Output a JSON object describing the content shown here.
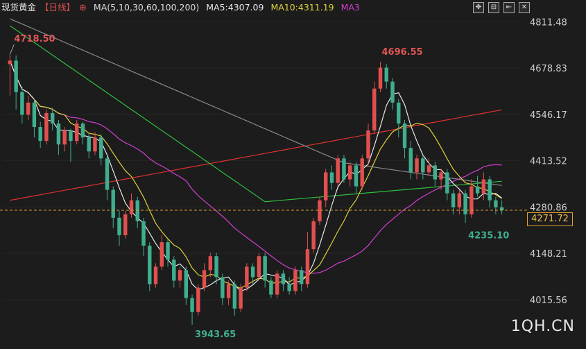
{
  "header": {
    "title": "现货黄金",
    "period": "【日线】",
    "plus": "⊕",
    "ma_label": "MA(5,10,30,60,100,200)",
    "ma5": "MA5:4307.09",
    "ma10": "MA10:4311.19",
    "ma3": "MA3"
  },
  "toolbar": {
    "btn1": "✥",
    "btn2": "⊟",
    "btn3": "⇤",
    "btn4": "✕"
  },
  "watermark": "1QH.CN",
  "current_price": "4271.72",
  "chart_data": {
    "type": "candlestick",
    "y_ticks": [
      "4811.48",
      "4678.83",
      "4546.17",
      "4413.52",
      "4280.86",
      "4148.21",
      "4015.56"
    ],
    "y_tick_values": [
      4811.48,
      4678.83,
      4546.17,
      4413.52,
      4280.86,
      4148.21,
      4015.56
    ],
    "ylim": [
      3900,
      4830
    ],
    "current": 4271.72,
    "annotations": {
      "high_left": "4718.50",
      "high_right": "4696.55",
      "low_mid": "3943.65",
      "low_right": "4235.10"
    },
    "colors": {
      "up": "#e0504f",
      "down": "#3fae8f",
      "ma5": "#e8e8e8",
      "ma10": "#e0d23b",
      "ma30": "#d23fd2",
      "ma60": "#2fbf3f",
      "ma100": "#8a8a8a",
      "ma200": "#e0302f",
      "current_line": "#e0a030"
    },
    "candles": [
      [
        4690,
        4700,
        4718.5,
        4600
      ],
      [
        4700,
        4610,
        4715,
        4560
      ],
      [
        4610,
        4545,
        4625,
        4520
      ],
      [
        4545,
        4580,
        4600,
        4530
      ],
      [
        4580,
        4510,
        4590,
        4480
      ],
      [
        4510,
        4470,
        4525,
        4450
      ],
      [
        4470,
        4550,
        4560,
        4460
      ],
      [
        4550,
        4520,
        4565,
        4500
      ],
      [
        4520,
        4460,
        4530,
        4430
      ],
      [
        4460,
        4500,
        4510,
        4440
      ],
      [
        4500,
        4470,
        4505,
        4410
      ],
      [
        4470,
        4520,
        4530,
        4460
      ],
      [
        4520,
        4480,
        4525,
        4460
      ],
      [
        4480,
        4440,
        4490,
        4420
      ],
      [
        4440,
        4480,
        4495,
        4430
      ],
      [
        4480,
        4420,
        4490,
        4400
      ],
      [
        4420,
        4330,
        4430,
        4300
      ],
      [
        4330,
        4250,
        4340,
        4220
      ],
      [
        4250,
        4200,
        4270,
        4170
      ],
      [
        4200,
        4260,
        4270,
        4190
      ],
      [
        4260,
        4300,
        4320,
        4250
      ],
      [
        4300,
        4240,
        4310,
        4220
      ],
      [
        4240,
        4170,
        4250,
        4140
      ],
      [
        4170,
        4060,
        4180,
        4040
      ],
      [
        4060,
        4110,
        4120,
        4050
      ],
      [
        4110,
        4180,
        4200,
        4100
      ],
      [
        4180,
        4130,
        4190,
        4110
      ],
      [
        4130,
        4070,
        4140,
        4050
      ],
      [
        4070,
        4100,
        4110,
        4050
      ],
      [
        4100,
        4020,
        4110,
        4000
      ],
      [
        4020,
        3980,
        4030,
        3943.65
      ],
      [
        3980,
        4050,
        4060,
        3970
      ],
      [
        4050,
        4100,
        4120,
        4040
      ],
      [
        4100,
        4140,
        4150,
        4080
      ],
      [
        4140,
        4080,
        4150,
        4060
      ],
      [
        4080,
        4020,
        4090,
        4000
      ],
      [
        4020,
        4060,
        4070,
        4000
      ],
      [
        4060,
        3990,
        4070,
        3970
      ],
      [
        3990,
        4050,
        4060,
        3980
      ],
      [
        4050,
        4110,
        4120,
        4040
      ],
      [
        4110,
        4080,
        4120,
        4060
      ],
      [
        4080,
        4140,
        4150,
        4070
      ],
      [
        4140,
        4070,
        4150,
        4050
      ],
      [
        4070,
        4030,
        4080,
        4020
      ],
      [
        4030,
        4090,
        4100,
        4020
      ],
      [
        4090,
        4060,
        4100,
        4040
      ],
      [
        4060,
        4040,
        4080,
        4030
      ],
      [
        4040,
        4100,
        4110,
        4030
      ],
      [
        4100,
        4060,
        4110,
        4040
      ],
      [
        4060,
        4160,
        4210,
        4050
      ],
      [
        4160,
        4240,
        4250,
        4150
      ],
      [
        4240,
        4300,
        4310,
        4230
      ],
      [
        4300,
        4380,
        4390,
        4280
      ],
      [
        4380,
        4350,
        4400,
        4330
      ],
      [
        4350,
        4420,
        4430,
        4340
      ],
      [
        4420,
        4360,
        4430,
        4350
      ],
      [
        4360,
        4400,
        4410,
        4340
      ],
      [
        4400,
        4340,
        4410,
        4320
      ],
      [
        4340,
        4420,
        4430,
        4330
      ],
      [
        4420,
        4500,
        4520,
        4400
      ],
      [
        4500,
        4620,
        4640,
        4490
      ],
      [
        4620,
        4680,
        4696.55,
        4610
      ],
      [
        4680,
        4640,
        4690,
        4620
      ],
      [
        4640,
        4580,
        4650,
        4560
      ],
      [
        4580,
        4520,
        4590,
        4480
      ],
      [
        4520,
        4450,
        4530,
        4420
      ],
      [
        4450,
        4380,
        4470,
        4360
      ],
      [
        4380,
        4420,
        4430,
        4360
      ],
      [
        4420,
        4380,
        4430,
        4360
      ],
      [
        4380,
        4400,
        4420,
        4370
      ],
      [
        4400,
        4360,
        4410,
        4340
      ],
      [
        4360,
        4380,
        4390,
        4330
      ],
      [
        4380,
        4320,
        4390,
        4300
      ],
      [
        4320,
        4280,
        4330,
        4260
      ],
      [
        4280,
        4320,
        4330,
        4260
      ],
      [
        4320,
        4260,
        4330,
        4235.1
      ],
      [
        4260,
        4340,
        4360,
        4250
      ],
      [
        4340,
        4320,
        4370,
        4310
      ],
      [
        4320,
        4360,
        4380,
        4300
      ],
      [
        4360,
        4300,
        4370,
        4280
      ],
      [
        4300,
        4280,
        4310,
        4260
      ],
      [
        4280,
        4271.72,
        4300,
        4260
      ]
    ]
  }
}
